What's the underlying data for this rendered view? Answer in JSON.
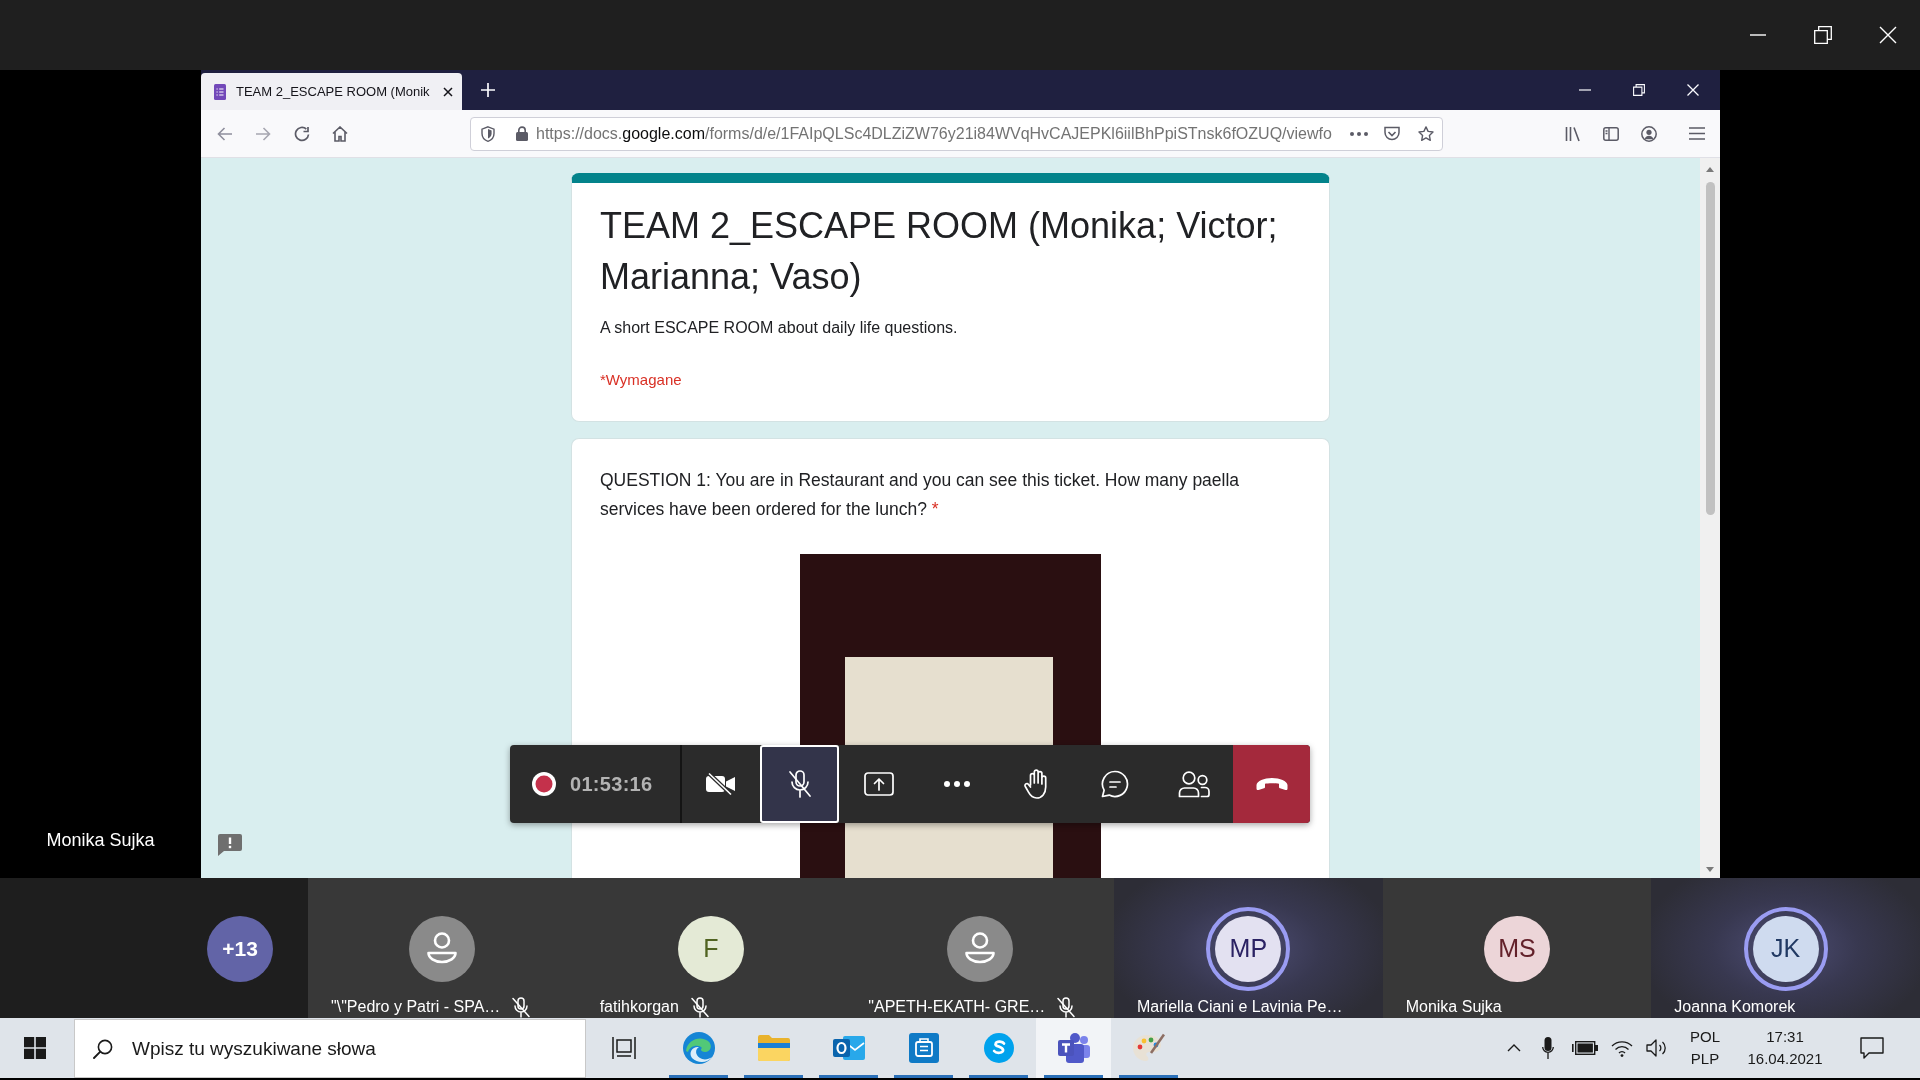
{
  "teams_window": {
    "presenter_name": "Monika Sujka"
  },
  "browser": {
    "tabs": [
      {
        "title": "TEAM 2_ESCAPE ROOM (Monik",
        "selected": true
      }
    ],
    "address": {
      "scheme_host": "https://docs.",
      "domain": "google.com",
      "path": "/forms/d/e/1FAIpQLSc4DLZiZW76y21i84WVqHvCAJEPKl6iilBhPpiSTnsk6fOZUQ/viewfo"
    }
  },
  "form": {
    "title": "TEAM 2_ESCAPE ROOM (Monika; Victor; Marianna; Vaso)",
    "description": "A short ESCAPE ROOM about daily life questions.",
    "required_note": "*Wymagane",
    "questions": [
      {
        "text": "QUESTION 1: You are in Restaurant and you can see this ticket. How many paella services have been ordered for the lunch?",
        "required_mark": "*"
      }
    ]
  },
  "call_controls": {
    "recording": true,
    "timer": "01:53:16",
    "buttons": [
      {
        "kind": "camera",
        "on": false,
        "focused": false
      },
      {
        "kind": "microphone",
        "on": false,
        "focused": true
      },
      {
        "kind": "share",
        "on": false,
        "focused": false
      },
      {
        "kind": "more",
        "on": false,
        "focused": false
      },
      {
        "kind": "raise-hand",
        "on": false,
        "focused": false
      },
      {
        "kind": "chat",
        "on": false,
        "focused": false
      },
      {
        "kind": "participants",
        "on": false,
        "focused": false
      },
      {
        "kind": "hang-up",
        "on": false,
        "focused": false
      }
    ]
  },
  "participants": {
    "overflow_count": "+13",
    "tiles": [
      {
        "kind": "silhouette",
        "name": "\"\\\"Pedro y Patri - SPA…",
        "muted": true,
        "speaking": false
      },
      {
        "kind": "initials",
        "initials": "F",
        "color": "#e4ead6",
        "name": "fatihkorgan",
        "muted": true,
        "speaking": false
      },
      {
        "kind": "silhouette",
        "name": "\"APETH-EKATH- GRE…",
        "muted": true,
        "speaking": false
      },
      {
        "kind": "initials",
        "initials": "MP",
        "color": "#e3e1f1",
        "name": "Mariella Ciani e Lavinia Pe…",
        "muted": false,
        "speaking": true
      },
      {
        "kind": "initials",
        "initials": "MS",
        "color": "#ecd5d8",
        "name": "Monika Sujka",
        "muted": false,
        "speaking": false
      },
      {
        "kind": "initials",
        "initials": "JK",
        "color": "#cfdbef",
        "name": "Joanna Komorek",
        "muted": false,
        "speaking": true
      }
    ]
  },
  "taskbar": {
    "search": {
      "placeholder": "Wpisz tu wyszukiwane słowa"
    },
    "apps": [
      {
        "kind": "task-view",
        "running": false,
        "active": false
      },
      {
        "kind": "browser",
        "running": true,
        "active": false
      },
      {
        "kind": "files",
        "running": true,
        "active": false
      },
      {
        "kind": "mail",
        "running": true,
        "active": false
      },
      {
        "kind": "store",
        "running": true,
        "active": false
      },
      {
        "kind": "messenger",
        "running": true,
        "active": false
      },
      {
        "kind": "teams",
        "running": true,
        "active": true
      },
      {
        "kind": "paint",
        "running": true,
        "active": false
      }
    ],
    "tray": {
      "language": "POL",
      "layout": "PLP",
      "time": "17:31",
      "date": "16.04.2021"
    }
  }
}
